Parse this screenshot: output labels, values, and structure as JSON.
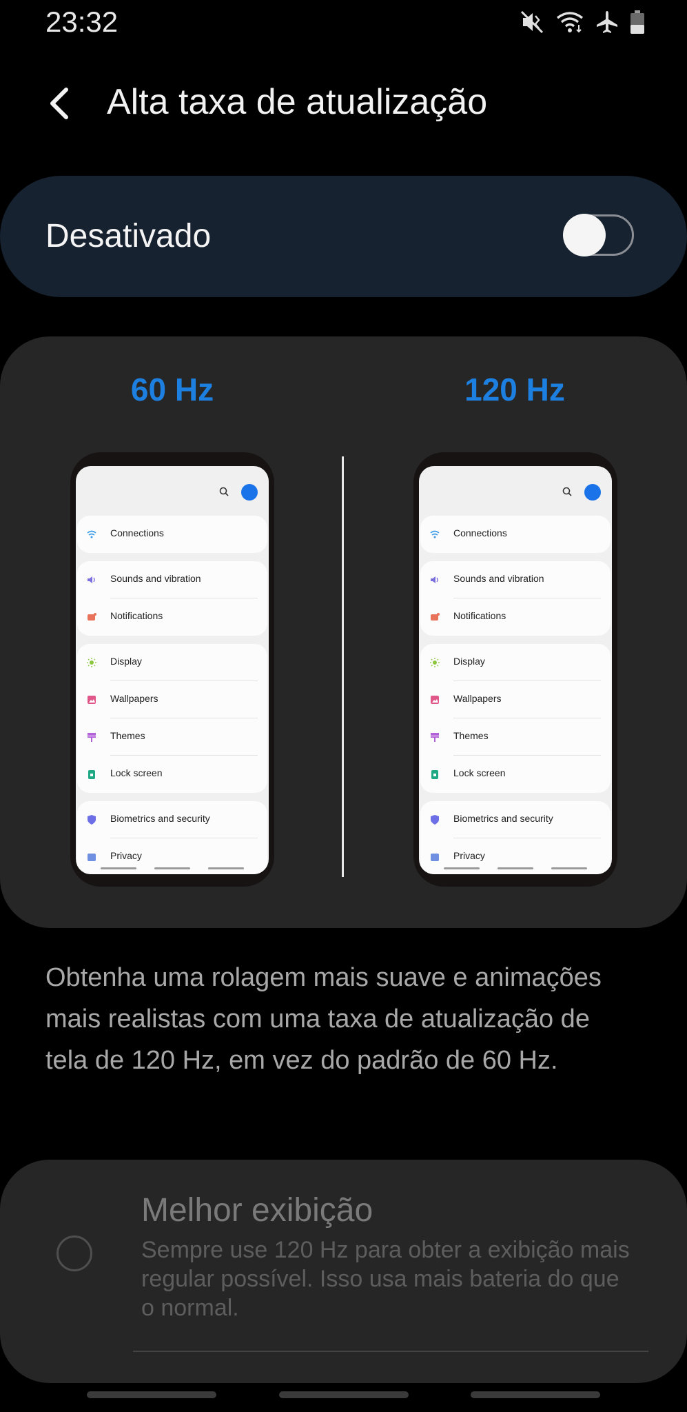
{
  "status_bar": {
    "time": "23:32",
    "icons": [
      "mute-icon",
      "wifi-icon",
      "airplane-icon",
      "battery-icon"
    ]
  },
  "header": {
    "title": "Alta taxa de atualização"
  },
  "toggle": {
    "label": "Desativado",
    "state": "off"
  },
  "comparison": {
    "left_label": "60 Hz",
    "right_label": "120 Hz",
    "phone_menu": {
      "groups": [
        [
          {
            "label": "Connections",
            "icon": "wifi-icon",
            "color": "#3b9be8"
          }
        ],
        [
          {
            "label": "Sounds and vibration",
            "icon": "volume-icon",
            "color": "#7b6fe0"
          },
          {
            "label": "Notifications",
            "icon": "notification-icon",
            "color": "#e8735a"
          }
        ],
        [
          {
            "label": "Display",
            "icon": "sun-icon",
            "color": "#8cc63f"
          },
          {
            "label": "Wallpapers",
            "icon": "image-icon",
            "color": "#e0588a"
          },
          {
            "label": "Themes",
            "icon": "brush-icon",
            "color": "#b361d8"
          },
          {
            "label": "Lock screen",
            "icon": "lock-icon",
            "color": "#1ea883"
          }
        ],
        [
          {
            "label": "Biometrics and security",
            "icon": "shield-icon",
            "color": "#6c6fe6"
          },
          {
            "label": "Privacy",
            "icon": "privacy-icon",
            "color": "#6f8fe0"
          }
        ]
      ]
    }
  },
  "description": "Obtenha uma rolagem mais suave e animações mais realistas com uma taxa de atualização de tela de 120 Hz, em vez do padrão de 60 Hz.",
  "option": {
    "title": "Melhor exibição",
    "description": "Sempre use 120 Hz para obter a exibição mais regular possível. Isso usa mais bateria do que o normal.",
    "selected": false
  },
  "colors": {
    "accent": "#1d80e0",
    "toggle_card": "#16222f",
    "card": "#262626"
  }
}
